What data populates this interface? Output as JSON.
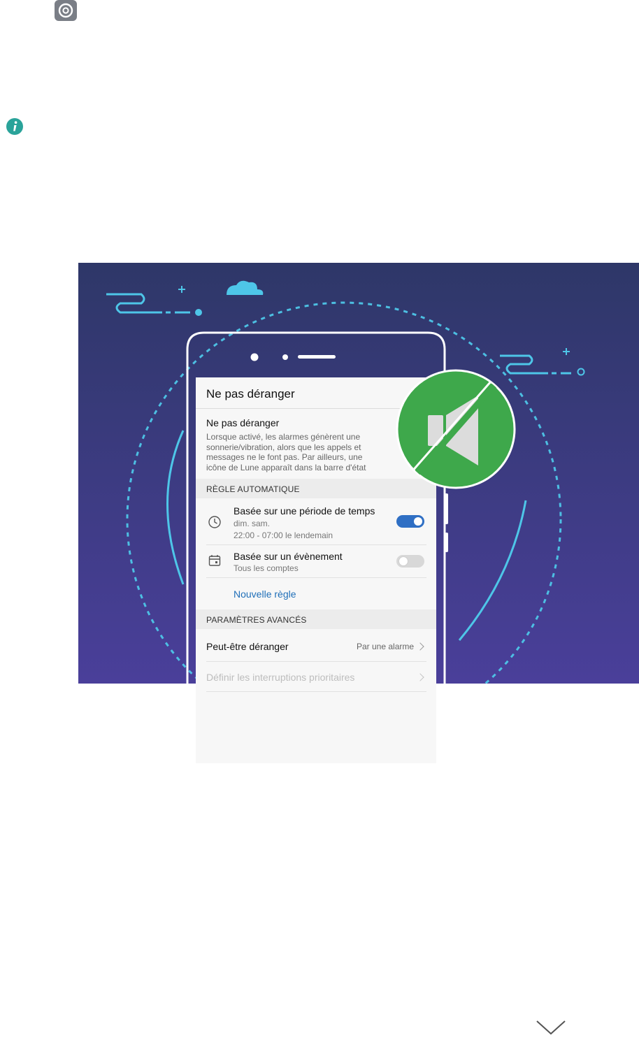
{
  "screen": {
    "title": "Ne pas déranger",
    "dnd": {
      "label": "Ne pas déranger",
      "description": "Lorsque activé, les alarmes génèrent une sonnerie/vibration, alors que les appels et messages ne le font pas. Par ailleurs, une icône de Lune apparaît dans la barre d'état"
    },
    "auto_rule": {
      "header": "RÈGLE AUTOMATIQUE",
      "rules": [
        {
          "title": "Basée sur une période de temps",
          "line1": "dim. sam.",
          "line2": "22:00 - 07:00 le lendemain",
          "enabled": true
        },
        {
          "title": "Basée sur un évènement",
          "line1": "Tous les comptes",
          "enabled": false
        }
      ],
      "new_rule": "Nouvelle règle"
    },
    "advanced": {
      "header": "PARAMÈTRES AVANCÉS",
      "maybe_disturb": {
        "label": "Peut-être déranger",
        "value": "Par une alarme"
      },
      "priority": {
        "label": "Définir les interruptions prioritaires"
      }
    }
  },
  "colors": {
    "hero_top": "#2e3768",
    "hero_bottom": "#4a3f9a",
    "accent_cyan": "#4ec6e8",
    "link_blue": "#1f6fb8",
    "toggle_on": "#2f6fc4",
    "badge_green": "#3ea84b"
  },
  "icons": [
    "settings-icon",
    "info-icon",
    "clock-icon",
    "calendar-icon",
    "speaker-muted-icon",
    "chevron-down-icon"
  ]
}
